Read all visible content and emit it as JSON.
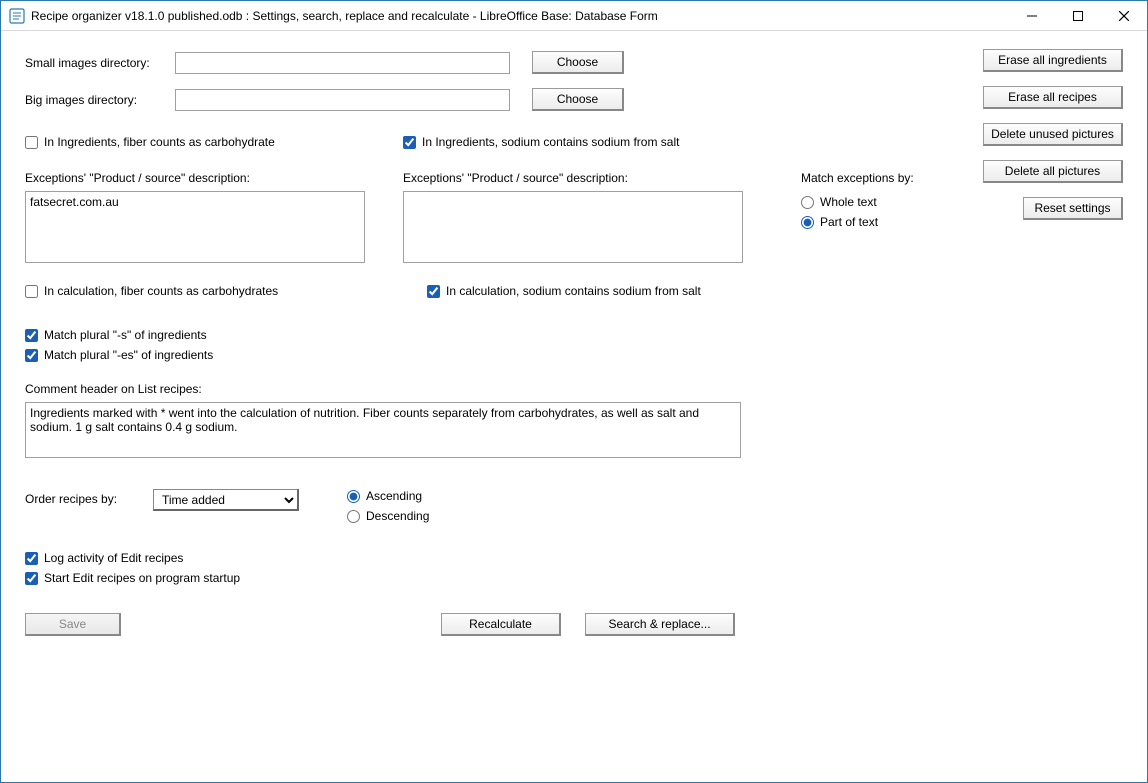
{
  "window": {
    "title": "Recipe organizer v18.1.0 published.odb : Settings, search, replace and recalculate - LibreOffice Base: Database Form"
  },
  "labels": {
    "small_images_dir": "Small images directory:",
    "big_images_dir": "Big images directory:",
    "choose": "Choose",
    "fiber_carb_ing": "In Ingredients, fiber counts as carbohydrate",
    "sodium_salt_ing": "In Ingredients, sodium contains sodium from salt",
    "exceptions_desc": "Exceptions' \"Product / source\" description:",
    "fiber_carb_calc": "In calculation, fiber counts as carbohydrates",
    "sodium_salt_calc": "In calculation, sodium contains sodium from salt",
    "match_plural_s": "Match plural \"-s\" of ingredients",
    "match_plural_es": "Match plural \"-es\" of ingredients",
    "comment_header": "Comment header on List recipes:",
    "order_by": "Order recipes by:",
    "ascending": "Ascending",
    "descending": "Descending",
    "log_activity": "Log activity of Edit recipes",
    "start_on_startup": "Start Edit recipes on program startup",
    "save": "Save",
    "recalculate": "Recalculate",
    "search_replace": "Search & replace...",
    "match_exceptions_by": "Match exceptions by:",
    "whole_text": "Whole text",
    "part_of_text": "Part of text"
  },
  "values": {
    "small_images_dir": "",
    "big_images_dir": "",
    "exceptions_left": "fatsecret.com.au",
    "exceptions_right": "",
    "fiber_carb_ing": false,
    "sodium_salt_ing": true,
    "fiber_carb_calc": false,
    "sodium_salt_calc": true,
    "match_plural_s": true,
    "match_plural_es": true,
    "comment_header": "Ingredients marked with * went into the calculation of nutrition. Fiber counts separately from carbohydrates, as well as salt and sodium. 1 g salt contains 0.4 g sodium.",
    "order_by": "Time added",
    "sort_dir": "ascending",
    "log_activity": true,
    "start_on_startup": true,
    "match_exceptions": "part"
  },
  "side_buttons": {
    "erase_ingredients": "Erase all ingredients",
    "erase_recipes": "Erase all recipes",
    "delete_unused": "Delete unused pictures",
    "delete_all": "Delete all pictures",
    "reset": "Reset settings"
  }
}
